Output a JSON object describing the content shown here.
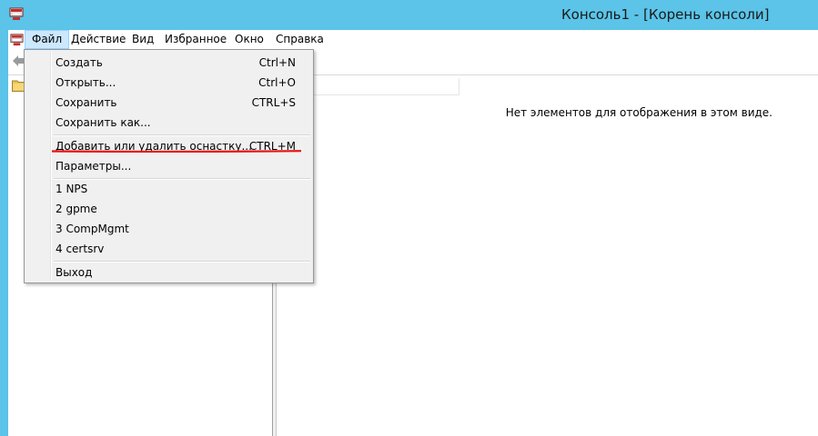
{
  "window": {
    "title": "Консоль1 - [Корень консоли]",
    "titlebar_color": "#5bc4e8"
  },
  "menubar": {
    "items": [
      {
        "label": "Файл",
        "active": true
      },
      {
        "label": "Действие"
      },
      {
        "label": "Вид"
      },
      {
        "label": "Избранное"
      },
      {
        "label": "Окно"
      },
      {
        "label": "Справка"
      }
    ]
  },
  "file_menu": {
    "items": [
      {
        "label": "Создать",
        "shortcut": "Ctrl+N"
      },
      {
        "label": "Открыть...",
        "shortcut": "Ctrl+O"
      },
      {
        "label": "Сохранить",
        "shortcut": "CTRL+S"
      },
      {
        "label": "Сохранить как...",
        "shortcut": ""
      },
      {
        "label": "Добавить или удалить оснастку...",
        "shortcut": "CTRL+M",
        "highlighted": true
      },
      {
        "label": "Параметры...",
        "shortcut": ""
      },
      {
        "label": "1 NPS",
        "shortcut": ""
      },
      {
        "label": "2 gpme",
        "shortcut": ""
      },
      {
        "label": "3 CompMgmt",
        "shortcut": ""
      },
      {
        "label": "4 certsrv",
        "shortcut": ""
      },
      {
        "label": "Выход",
        "shortcut": ""
      }
    ],
    "highlight_color": "#e81010"
  },
  "list_pane": {
    "empty_message": "Нет элементов для отображения в этом виде."
  },
  "icons": {
    "app": "mmc-console-icon",
    "child": "mmc-child-icon",
    "back": "back-arrow-icon",
    "tree_root": "folder-icon"
  }
}
